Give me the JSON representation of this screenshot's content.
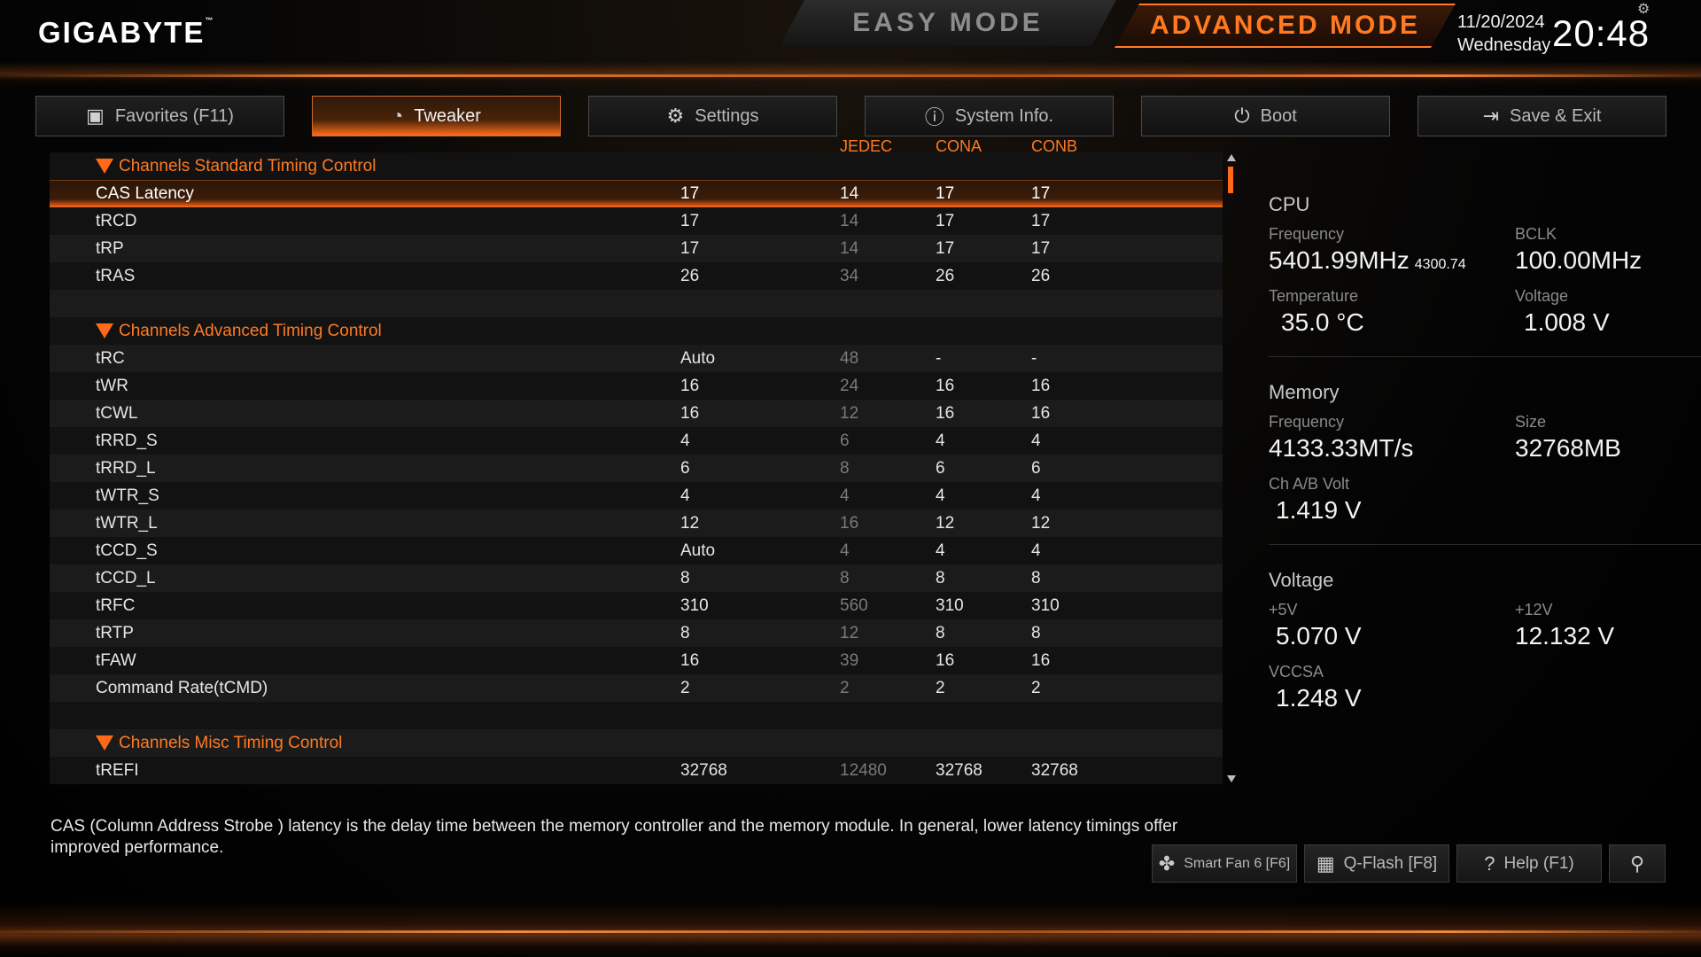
{
  "header": {
    "logo": "GIGABYTE",
    "logo_tm": "™",
    "easy_mode": "EASY MODE",
    "advanced_mode": "ADVANCED MODE",
    "date": "11/20/2024",
    "weekday": "Wednesday",
    "time": "20:48"
  },
  "tabs": [
    {
      "label": "Favorites (F11)",
      "icon": "star-folder-icon"
    },
    {
      "label": "Tweaker",
      "icon": "gauge-icon",
      "active": true
    },
    {
      "label": "Settings",
      "icon": "gear-icon"
    },
    {
      "label": "System Info.",
      "icon": "info-icon"
    },
    {
      "label": "Boot",
      "icon": "power-icon"
    },
    {
      "label": "Save & Exit",
      "icon": "exit-icon"
    }
  ],
  "columns": {
    "jedec": "JEDEC",
    "cona": "CONA",
    "conb": "CONB"
  },
  "sections": {
    "standard": "Channels Standard Timing Control",
    "advanced": "Channels Advanced Timing Control",
    "misc": "Channels Misc Timing Control"
  },
  "rows_standard": [
    {
      "label": "CAS Latency",
      "value": "17",
      "jedec": "14",
      "cona": "17",
      "conb": "17"
    },
    {
      "label": "tRCD",
      "value": "17",
      "jedec": "14",
      "cona": "17",
      "conb": "17"
    },
    {
      "label": "tRP",
      "value": "17",
      "jedec": "14",
      "cona": "17",
      "conb": "17"
    },
    {
      "label": "tRAS",
      "value": "26",
      "jedec": "34",
      "cona": "26",
      "conb": "26"
    }
  ],
  "rows_advanced": [
    {
      "label": "tRC",
      "value": "Auto",
      "jedec": "48",
      "cona": "-",
      "conb": "-"
    },
    {
      "label": "tWR",
      "value": "16",
      "jedec": "24",
      "cona": "16",
      "conb": "16"
    },
    {
      "label": "tCWL",
      "value": "16",
      "jedec": "12",
      "cona": "16",
      "conb": "16"
    },
    {
      "label": "tRRD_S",
      "value": "4",
      "jedec": "6",
      "cona": "4",
      "conb": "4"
    },
    {
      "label": "tRRD_L",
      "value": "6",
      "jedec": "8",
      "cona": "6",
      "conb": "6"
    },
    {
      "label": "tWTR_S",
      "value": "4",
      "jedec": "4",
      "cona": "4",
      "conb": "4"
    },
    {
      "label": "tWTR_L",
      "value": "12",
      "jedec": "16",
      "cona": "12",
      "conb": "12"
    },
    {
      "label": "tCCD_S",
      "value": "Auto",
      "jedec": "4",
      "cona": "4",
      "conb": "4"
    },
    {
      "label": "tCCD_L",
      "value": "8",
      "jedec": "8",
      "cona": "8",
      "conb": "8"
    },
    {
      "label": "tRFC",
      "value": "310",
      "jedec": "560",
      "cona": "310",
      "conb": "310"
    },
    {
      "label": "tRTP",
      "value": "8",
      "jedec": "12",
      "cona": "8",
      "conb": "8"
    },
    {
      "label": "tFAW",
      "value": "16",
      "jedec": "39",
      "cona": "16",
      "conb": "16"
    },
    {
      "label": "Command Rate(tCMD)",
      "value": "2",
      "jedec": "2",
      "cona": "2",
      "conb": "2"
    }
  ],
  "rows_misc": [
    {
      "label": "tREFI",
      "value": "32768",
      "jedec": "12480",
      "cona": "32768",
      "conb": "32768"
    }
  ],
  "info": {
    "cpu": {
      "title": "CPU",
      "freq_label": "Frequency",
      "freq": "5401.99MHz",
      "freq_sub": "4300.74",
      "bclk_label": "BCLK",
      "bclk": "100.00MHz",
      "temp_label": "Temperature",
      "temp": "35.0 °C",
      "volt_label": "Voltage",
      "volt": "1.008 V"
    },
    "memory": {
      "title": "Memory",
      "freq_label": "Frequency",
      "freq": "4133.33MT/s",
      "size_label": "Size",
      "size": "32768MB",
      "chvolt_label": "Ch A/B Volt",
      "chvolt": "1.419 V"
    },
    "voltage": {
      "title": "Voltage",
      "p5_label": "+5V",
      "p5": "5.070 V",
      "p12_label": "+12V",
      "p12": "12.132 V",
      "vccsa_label": "VCCSA",
      "vccsa": "1.248 V"
    }
  },
  "description": "CAS (Column Address Strobe ) latency is the delay time between the memory controller and the memory module. In general, lower latency timings offer improved performance.",
  "bottom_buttons": [
    {
      "label": "Smart Fan 6 [F6]",
      "icon": "fan-icon"
    },
    {
      "label": "Q-Flash [F8]",
      "icon": "chip-icon"
    },
    {
      "label": "Help (F1)",
      "icon": "help-icon"
    },
    {
      "label": "",
      "icon": "search-icon"
    }
  ],
  "colors": {
    "accent": "#ff7a22",
    "background": "#000000"
  }
}
